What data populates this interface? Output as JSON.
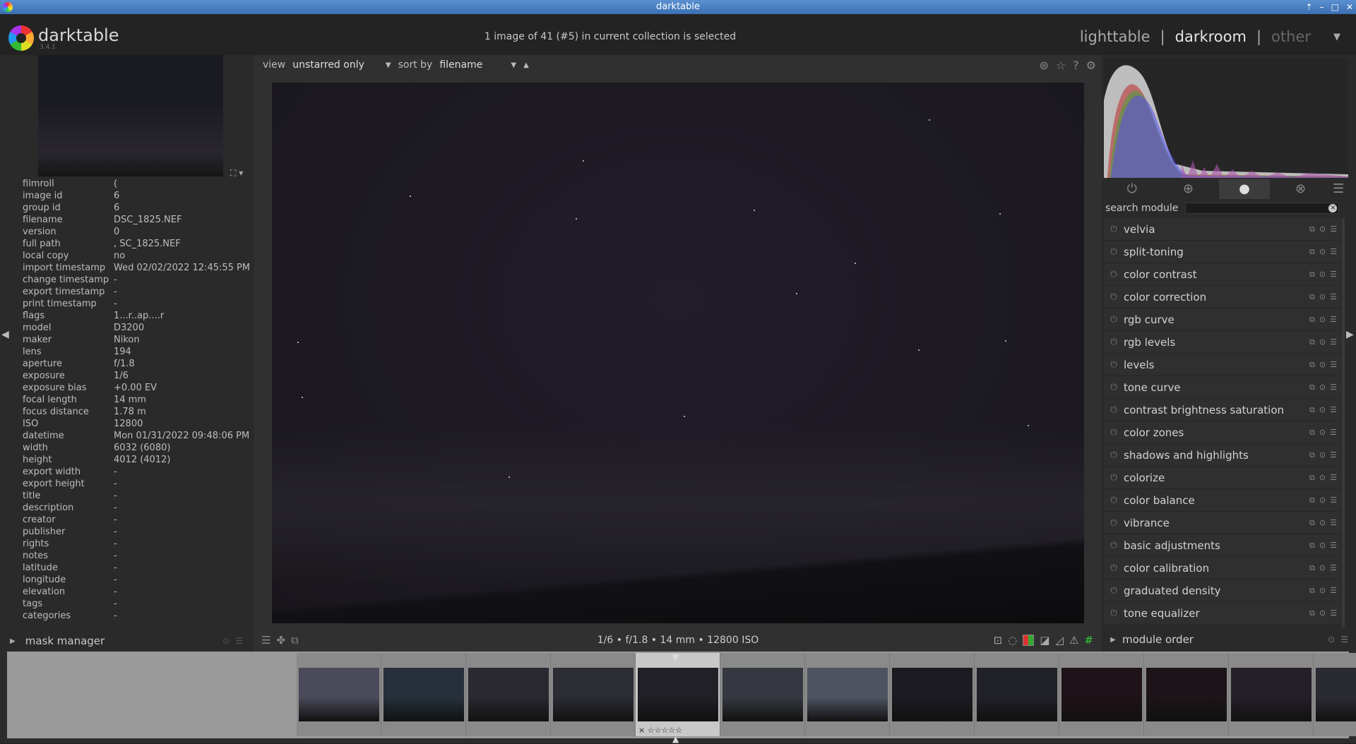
{
  "window": {
    "title": "darktable"
  },
  "header": {
    "logo": "darktable",
    "version": "3.4.1",
    "selection_info": "1 image of 41 (#5) in current collection is selected",
    "views": [
      "lighttable",
      "darkroom",
      "other"
    ],
    "separator": "|"
  },
  "left": {
    "image_info": [
      {
        "k": "filmroll",
        "v": "("
      },
      {
        "k": "image id",
        "v": "6"
      },
      {
        "k": "group id",
        "v": "6"
      },
      {
        "k": "filename",
        "v": "DSC_1825.NEF"
      },
      {
        "k": "version",
        "v": "0"
      },
      {
        "k": "full path",
        "v": ",                    SC_1825.NEF"
      },
      {
        "k": "local copy",
        "v": "no"
      },
      {
        "k": "import timestamp",
        "v": "Wed 02/02/2022 12:45:55 PM"
      },
      {
        "k": "change timestamp",
        "v": "-"
      },
      {
        "k": "export timestamp",
        "v": "-"
      },
      {
        "k": "print timestamp",
        "v": "-"
      },
      {
        "k": "flags",
        "v": "1...r..ap....r"
      },
      {
        "k": "model",
        "v": "D3200"
      },
      {
        "k": "maker",
        "v": "Nikon"
      },
      {
        "k": "lens",
        "v": "194"
      },
      {
        "k": "aperture",
        "v": "f/1.8"
      },
      {
        "k": "exposure",
        "v": "1/6"
      },
      {
        "k": "exposure bias",
        "v": "+0.00 EV"
      },
      {
        "k": "focal length",
        "v": "14 mm"
      },
      {
        "k": "focus distance",
        "v": "1.78 m"
      },
      {
        "k": "ISO",
        "v": "12800"
      },
      {
        "k": "datetime",
        "v": "Mon 01/31/2022 09:48:06 PM"
      },
      {
        "k": "width",
        "v": "6032 (6080)"
      },
      {
        "k": "height",
        "v": "4012 (4012)"
      },
      {
        "k": "export width",
        "v": "-"
      },
      {
        "k": "export height",
        "v": "-"
      },
      {
        "k": "title",
        "v": "-"
      },
      {
        "k": "description",
        "v": "-"
      },
      {
        "k": "creator",
        "v": "-"
      },
      {
        "k": "publisher",
        "v": "-"
      },
      {
        "k": "rights",
        "v": "-"
      },
      {
        "k": "notes",
        "v": "-"
      },
      {
        "k": "latitude",
        "v": "-"
      },
      {
        "k": "longitude",
        "v": "-"
      },
      {
        "k": "elevation",
        "v": "-"
      },
      {
        "k": "tags",
        "v": "-"
      },
      {
        "k": "categories",
        "v": "-"
      }
    ],
    "mask_manager": "mask manager"
  },
  "center": {
    "view_label": "view",
    "view_value": "unstarred only",
    "sort_label": "sort by",
    "sort_value": "filename",
    "exif_line": "1/6 • f/1.8 • 14 mm • 12800 ISO"
  },
  "right": {
    "search_label": "search module",
    "search_value": "",
    "modules": [
      "velvia",
      "split-toning",
      "color contrast",
      "color correction",
      "rgb curve",
      "rgb levels",
      "levels",
      "tone curve",
      "contrast brightness saturation",
      "color zones",
      "shadows and highlights",
      "colorize",
      "color balance",
      "vibrance",
      "basic adjustments",
      "color calibration",
      "graduated density",
      "tone equalizer"
    ],
    "module_order": "module order",
    "active_group": "color-group-icon"
  },
  "filmstrip": {
    "count_shown": 13,
    "selected_index": 4,
    "selected_rating": "☆☆☆☆☆",
    "reject_mark": "×"
  }
}
